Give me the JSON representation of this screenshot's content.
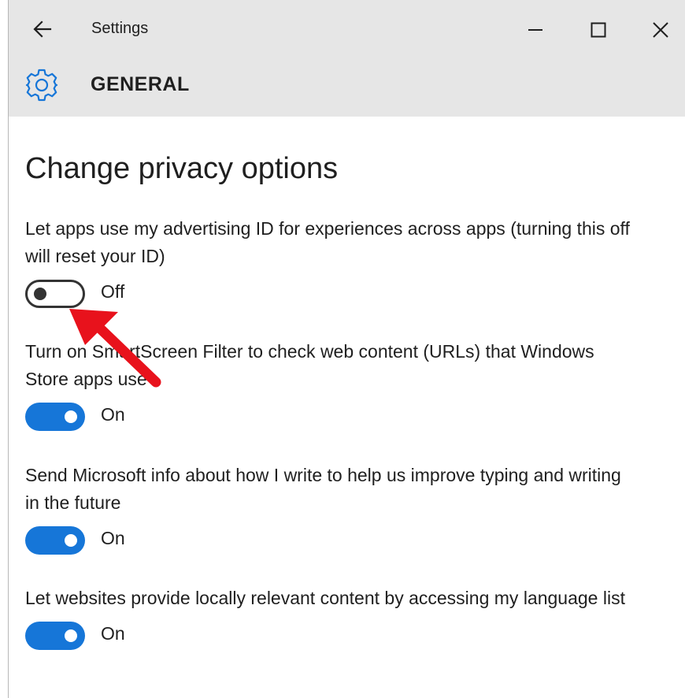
{
  "window": {
    "title": "Settings"
  },
  "header": {
    "section": "GENERAL"
  },
  "main": {
    "title": "Change privacy options",
    "settings": [
      {
        "label": "Let apps use my advertising ID for experiences across apps (turning this off will reset your ID)",
        "state": "Off",
        "on": false
      },
      {
        "label": "Turn on SmartScreen Filter to check web content (URLs) that Windows Store apps use",
        "state": "On",
        "on": true
      },
      {
        "label": "Send Microsoft info about how I write to help us improve typing and writing in the future",
        "state": "On",
        "on": true
      },
      {
        "label": "Let websites provide locally relevant content by accessing my language list",
        "state": "On",
        "on": true
      }
    ]
  },
  "colors": {
    "accent": "#1676d8",
    "titlebar": "#e6e6e6",
    "annotation_arrow": "#e8121c"
  },
  "icons": {
    "back": "arrow-left-icon",
    "minimize": "minimize-icon",
    "maximize": "maximize-icon",
    "close": "close-icon",
    "section": "gear-icon"
  }
}
